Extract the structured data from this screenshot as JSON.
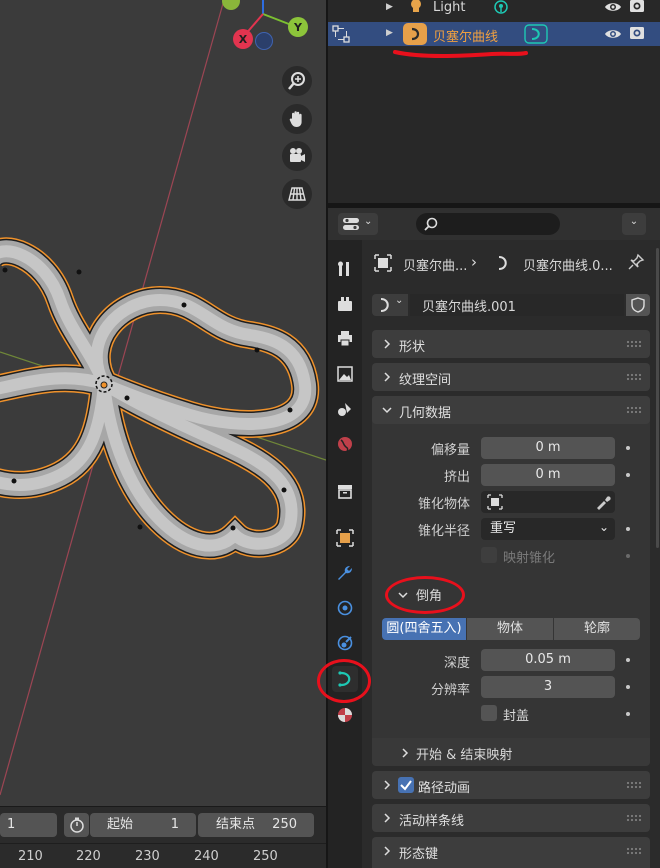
{
  "viewport": {
    "gizmo": {
      "x": "X",
      "y": "Y"
    }
  },
  "timeline": {
    "current_frame": "1",
    "start_label": "起始",
    "start_value": "1",
    "end_label": "结束点",
    "end_value": "250",
    "ruler": [
      "210",
      "220",
      "230",
      "240",
      "250"
    ]
  },
  "outliner": {
    "rows": [
      {
        "label": "Light"
      },
      {
        "label": "贝塞尔曲线"
      }
    ]
  },
  "properties": {
    "search": {
      "placeholder": ""
    },
    "breadcrumb": {
      "object": "贝塞尔曲...",
      "data": "贝塞尔曲线.0..."
    },
    "datablock_name": "贝塞尔曲线.001",
    "panels": {
      "shape": "形状",
      "texture_space": "纹理空间",
      "geometry": "几何数据",
      "bevel": "倒角",
      "start_end": "开始 & 结束映射",
      "path_anim": "路径动画",
      "active_spline": "活动样条线",
      "shape_keys": "形态键"
    },
    "geometry": {
      "offset_label": "偏移量",
      "offset_value": "0 m",
      "extrude_label": "挤出",
      "extrude_value": "0 m",
      "taper_obj_label": "锥化物体",
      "taper_radius_label": "锥化半径",
      "taper_radius_value": "重写",
      "map_taper_label": "映射锥化"
    },
    "bevel": {
      "modes": [
        "圆(四舍五入)",
        "物体",
        "轮廓"
      ],
      "active_mode": 0,
      "depth_label": "深度",
      "depth_value": "0.05 m",
      "resolution_label": "分辨率",
      "resolution_value": "3",
      "fill_caps_label": "封盖"
    }
  },
  "colors": {
    "accent": "#4772b3",
    "selection_orange": "#f0922b",
    "annotation_red": "#e8101c",
    "curve_teal": "#1ec8b4"
  }
}
